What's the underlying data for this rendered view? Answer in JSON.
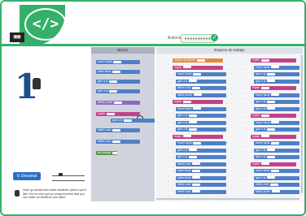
{
  "header": {
    "logo_text": "▣▣",
    "badge_glyph": "</>",
    "actions_label": "Actions:",
    "actions_value": "●●●●●●●●●●",
    "actions_check": "✓",
    "brand_color": "#35b06b"
  },
  "left_panel": {
    "puzzle_number": "1",
    "draw_button": "↻ Dessinar",
    "help_text": "Have go ahead and make whatever picture you'd like! You've even got an empty function that you can make do whatever you want!"
  },
  "toolbox": {
    "title": "Blocks",
    "blocks": [
      {
        "color": "blue",
        "label": "mover hacia"
      },
      {
        "color": "blue",
        "label": "saltar hacia"
      },
      {
        "color": "blue",
        "label": "girar a la"
      },
      {
        "color": "blue",
        "label": "girar a la"
      },
      {
        "color": "purple",
        "label": "definir pincel"
      },
      {
        "color": "pink",
        "label": "repetir"
      },
      {
        "color": "blue",
        "label": "girar a la"
      },
      {
        "color": "blue",
        "label": "definir color"
      },
      {
        "color": "blue",
        "label": "definir color"
      },
      {
        "color": "green",
        "label": "my function"
      }
    ]
  },
  "workspace": {
    "title": "Espacio de trabajo",
    "col1": [
      {
        "color": "orange",
        "label": "cuando se ejecute"
      },
      {
        "color": "pink",
        "label": "repetir"
      },
      {
        "color": "blue",
        "label": "mover hacia"
      },
      {
        "color": "blue",
        "label": "girar a la"
      },
      {
        "color": "blue",
        "label": "definir color"
      },
      {
        "color": "blue",
        "label": "definir pincel"
      },
      {
        "color": "pink",
        "label": "repetir"
      },
      {
        "color": "blue",
        "label": "mover hacia"
      },
      {
        "color": "blue",
        "label": "girar a la"
      },
      {
        "color": "blue",
        "label": "girar a la"
      },
      {
        "color": "blue",
        "label": "girar a la"
      },
      {
        "color": "pink",
        "label": "repetir"
      },
      {
        "color": "blue",
        "label": "mover hacia"
      },
      {
        "color": "blue",
        "label": "girar a la"
      },
      {
        "color": "blue",
        "label": "girar a la"
      },
      {
        "color": "blue",
        "label": "definir color"
      },
      {
        "color": "blue",
        "label": "saltar hacia"
      },
      {
        "color": "blue",
        "label": "saltar hacia"
      },
      {
        "color": "blue",
        "label": "definir color"
      },
      {
        "color": "blue",
        "label": "definir color"
      }
    ],
    "col2": [
      {
        "color": "pink",
        "label": "repetir"
      },
      {
        "color": "blue",
        "label": "mover hacia"
      },
      {
        "color": "blue",
        "label": "girar a la"
      },
      {
        "color": "blue",
        "label": "girar a la"
      },
      {
        "color": "pink",
        "label": "repetir"
      },
      {
        "color": "blue",
        "label": "mover hacia"
      },
      {
        "color": "blue",
        "label": "girar a la"
      },
      {
        "color": "blue",
        "label": "girar a la"
      },
      {
        "color": "pink",
        "label": "repetir"
      },
      {
        "color": "blue",
        "label": "mover hacia"
      },
      {
        "color": "blue",
        "label": "girar a la"
      },
      {
        "color": "pink",
        "label": "repetir"
      },
      {
        "color": "blue",
        "label": "mover hacia"
      },
      {
        "color": "blue",
        "label": "girar a la"
      },
      {
        "color": "blue",
        "label": "girar a la"
      },
      {
        "color": "pink",
        "label": "repetir"
      },
      {
        "color": "blue",
        "label": "mover hacia"
      },
      {
        "color": "blue",
        "label": "girar a la"
      },
      {
        "color": "blue",
        "label": "definir color"
      },
      {
        "color": "blue",
        "label": "definir pincel"
      }
    ]
  }
}
